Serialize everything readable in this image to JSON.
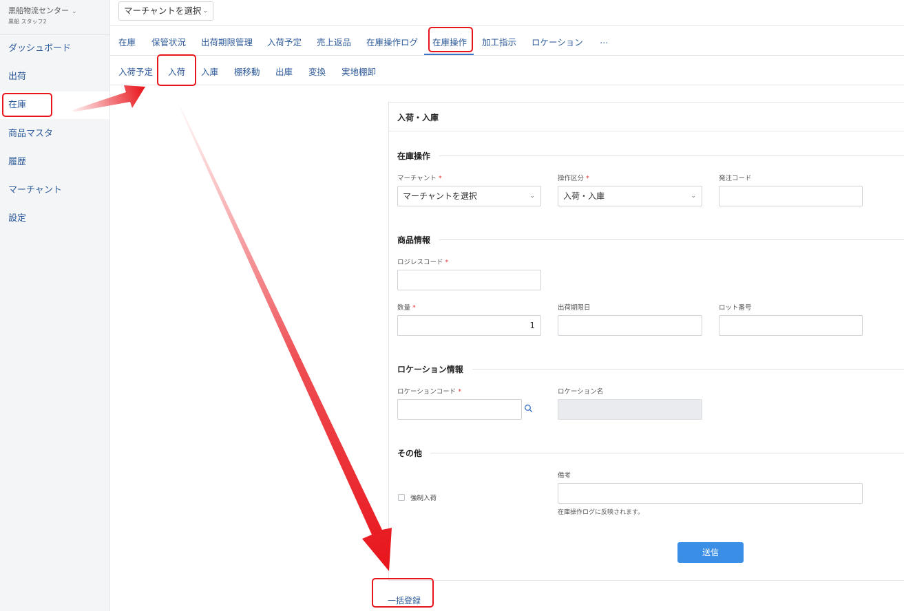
{
  "sidebar": {
    "org_name": "黒船物流センター",
    "user_name": "黒船 スタッフ2",
    "items": [
      {
        "label": "ダッシュボード"
      },
      {
        "label": "出荷"
      },
      {
        "label": "在庫"
      },
      {
        "label": "商品マスタ"
      },
      {
        "label": "履歴"
      },
      {
        "label": "マーチャント"
      },
      {
        "label": "設定"
      }
    ],
    "active_item": "在庫"
  },
  "header": {
    "merchant_select_value": "マーチャントを選択"
  },
  "tabs": [
    {
      "label": "在庫"
    },
    {
      "label": "保管状況"
    },
    {
      "label": "出荷期限管理"
    },
    {
      "label": "入荷予定"
    },
    {
      "label": "売上返品"
    },
    {
      "label": "在庫操作ログ"
    },
    {
      "label": "在庫操作"
    },
    {
      "label": "加工指示"
    },
    {
      "label": "ロケーション"
    },
    {
      "label": "…"
    }
  ],
  "active_tab": "在庫操作",
  "subtabs": [
    {
      "label": "入荷予定"
    },
    {
      "label": "入荷"
    },
    {
      "label": "入庫"
    },
    {
      "label": "棚移動"
    },
    {
      "label": "出庫"
    },
    {
      "label": "変換"
    },
    {
      "label": "実地棚卸"
    }
  ],
  "active_subtab": "入荷",
  "form": {
    "title": "入荷・入庫",
    "sections": {
      "operation": "在庫操作",
      "product": "商品情報",
      "location": "ロケーション情報",
      "other": "その他"
    },
    "fields": {
      "merchant": {
        "label": "マーチャント",
        "value": "マーチャントを選択"
      },
      "operation_type": {
        "label": "操作区分",
        "value": "入荷・入庫"
      },
      "order_code": {
        "label": "発注コード",
        "value": ""
      },
      "logiless_code": {
        "label": "ロジレスコード",
        "value": ""
      },
      "quantity": {
        "label": "数量",
        "value": "1"
      },
      "ship_deadline": {
        "label": "出荷期限日",
        "value": ""
      },
      "lot_number": {
        "label": "ロット番号",
        "value": ""
      },
      "location_code": {
        "label": "ロケーションコード",
        "value": ""
      },
      "location_name": {
        "label": "ロケーション名",
        "value": ""
      },
      "force_receive": {
        "label": "強制入荷",
        "checked": false
      },
      "remarks": {
        "label": "備考",
        "value": "",
        "help": "在庫操作ログに反映されます。"
      }
    },
    "required_mark": "*",
    "submit_label": "送信"
  },
  "bulk_link": "一括登録",
  "colors": {
    "link": "#2d5a9a",
    "accent": "#3a8ee6",
    "annotation": "#e8141b",
    "required": "#e03c3c"
  },
  "icons": [
    "chevron-down-icon",
    "search-icon"
  ]
}
